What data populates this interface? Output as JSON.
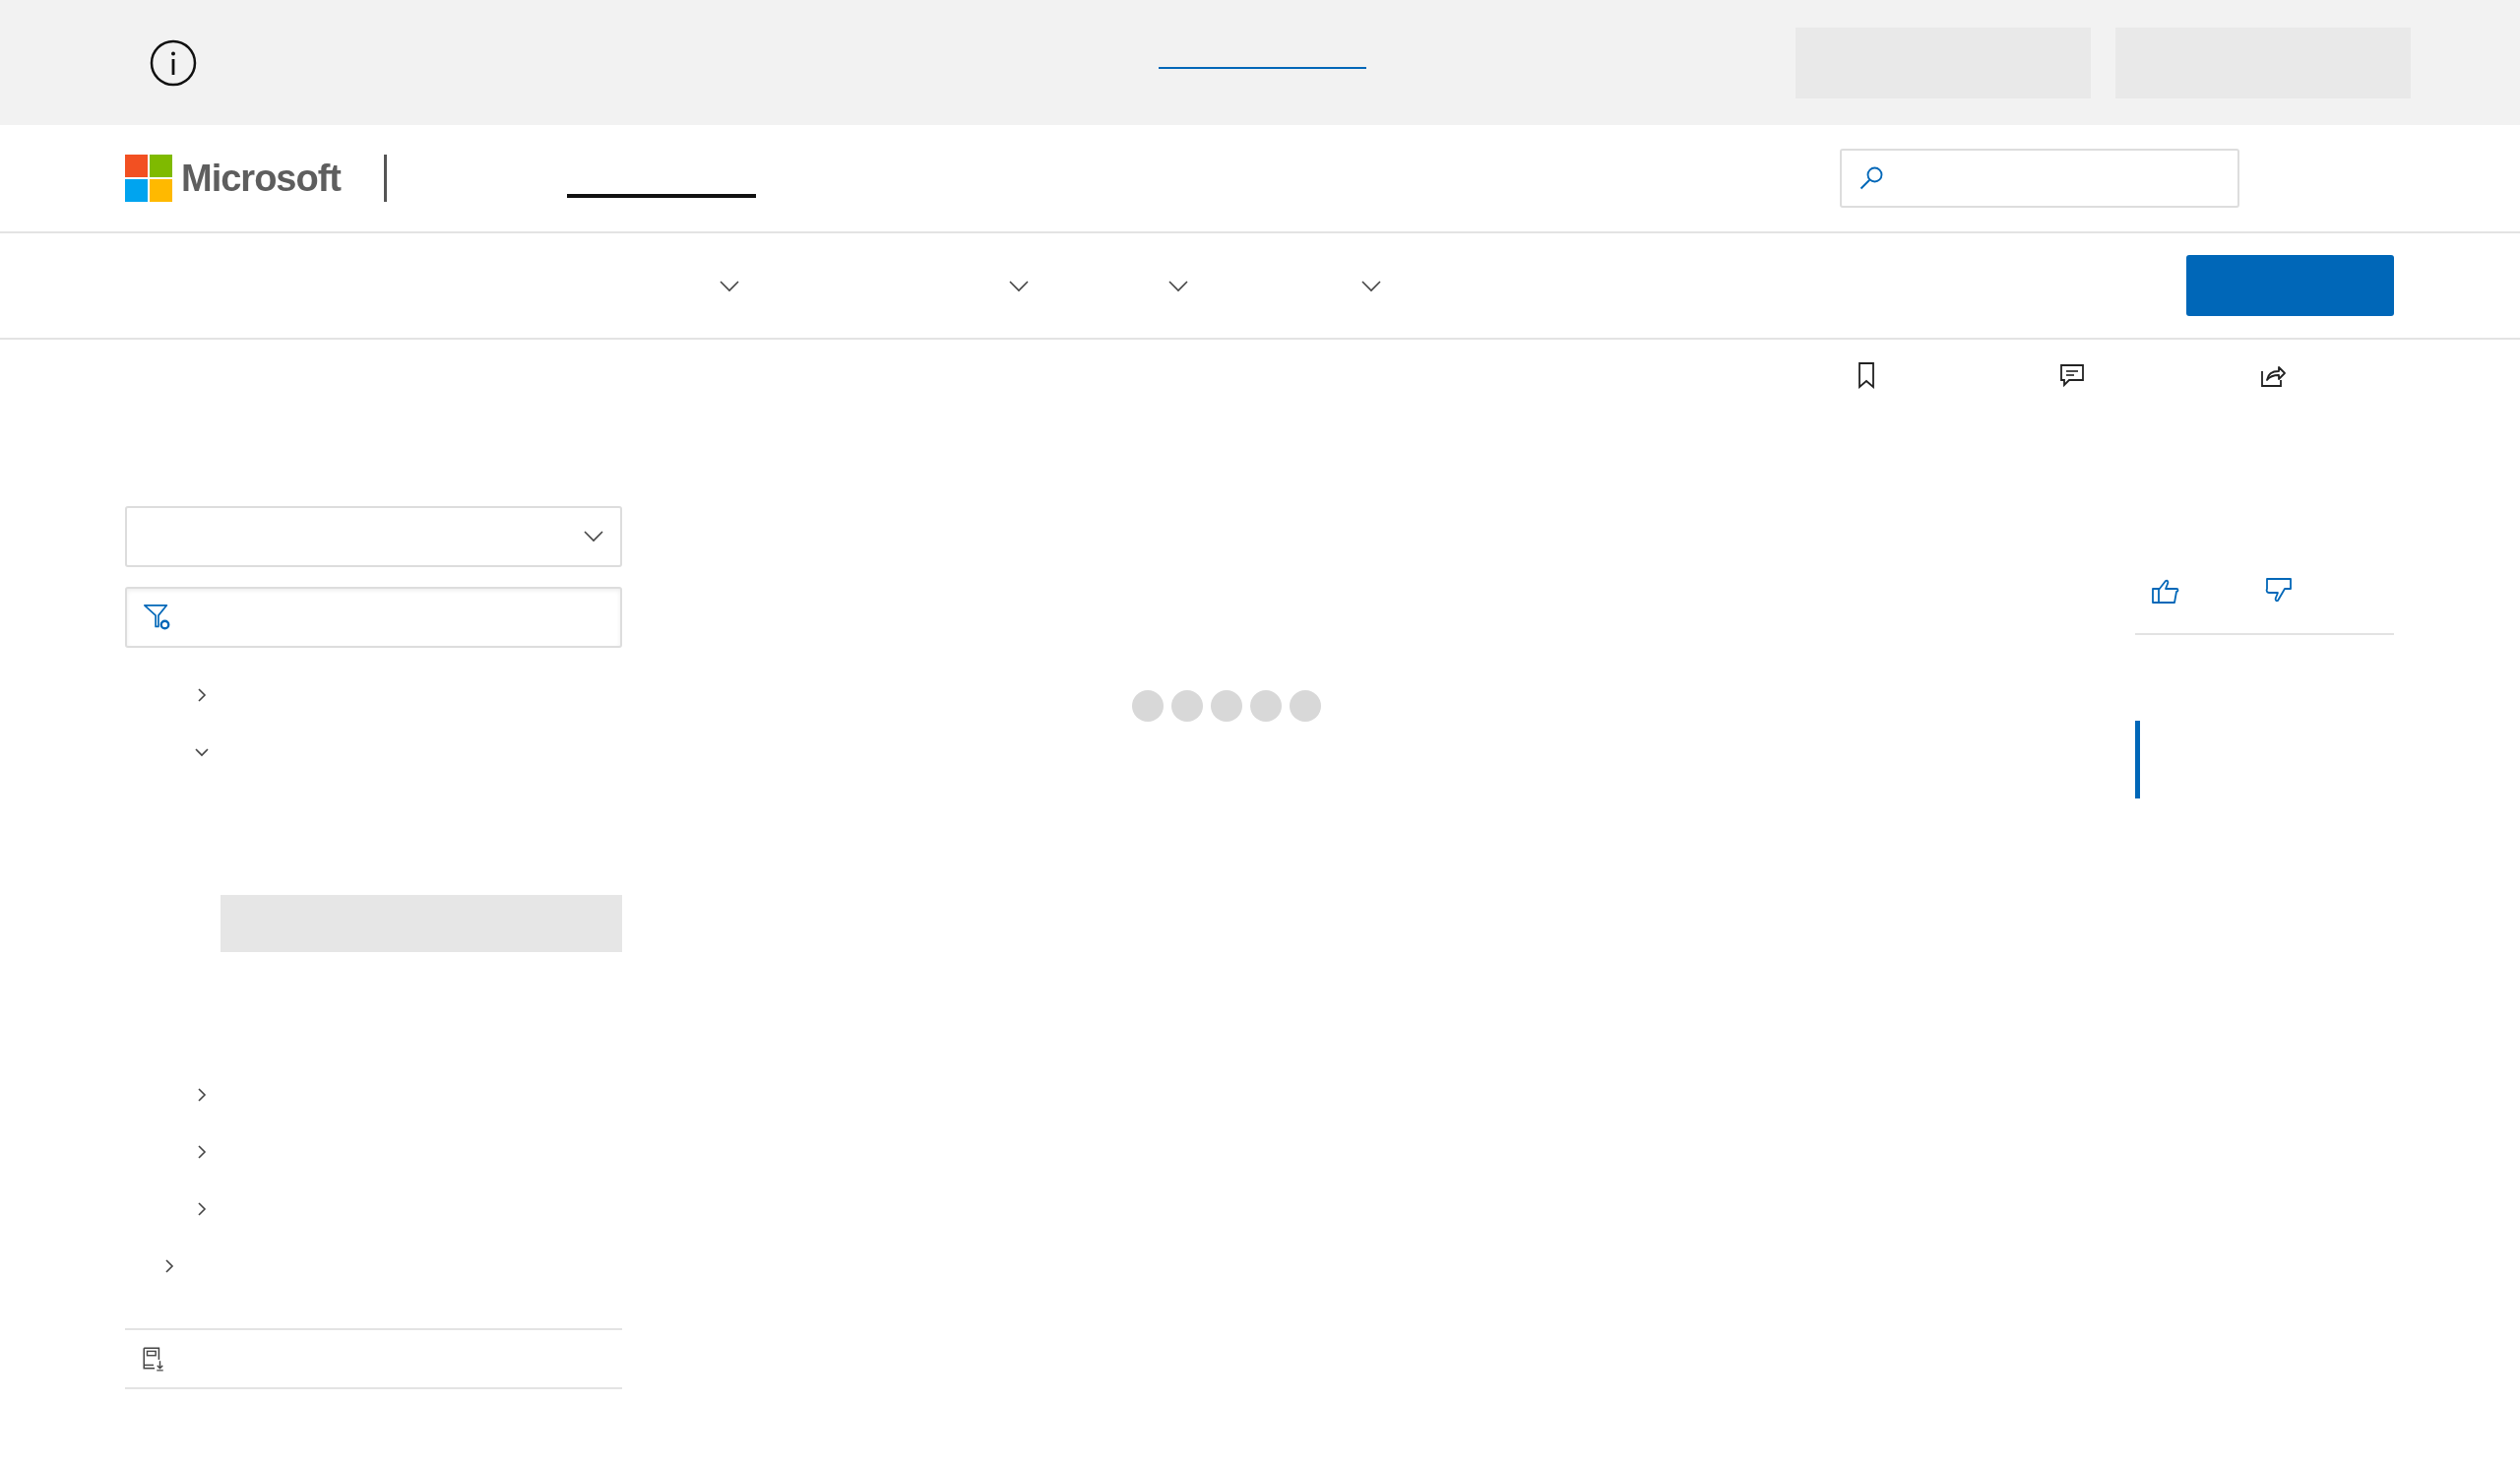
{
  "header": {
    "brand": "Microsoft"
  },
  "left_nav": {
    "tree": [
      {
        "kind": "group",
        "children": [
          {
            "kind": "node",
            "expanded": false
          },
          {
            "kind": "node",
            "expanded": true,
            "children": [
              {
                "kind": "leaf",
                "selected": false
              },
              {
                "kind": "leaf",
                "selected": false
              },
              {
                "kind": "leaf",
                "selected": true
              },
              {
                "kind": "leaf",
                "selected": false
              },
              {
                "kind": "leaf",
                "selected": false
              }
            ]
          },
          {
            "kind": "node",
            "expanded": false
          },
          {
            "kind": "node",
            "expanded": false
          },
          {
            "kind": "node",
            "expanded": false
          }
        ]
      },
      {
        "kind": "node",
        "expanded": false
      }
    ]
  },
  "toc": {
    "items": [
      {
        "selected": true
      }
    ]
  }
}
